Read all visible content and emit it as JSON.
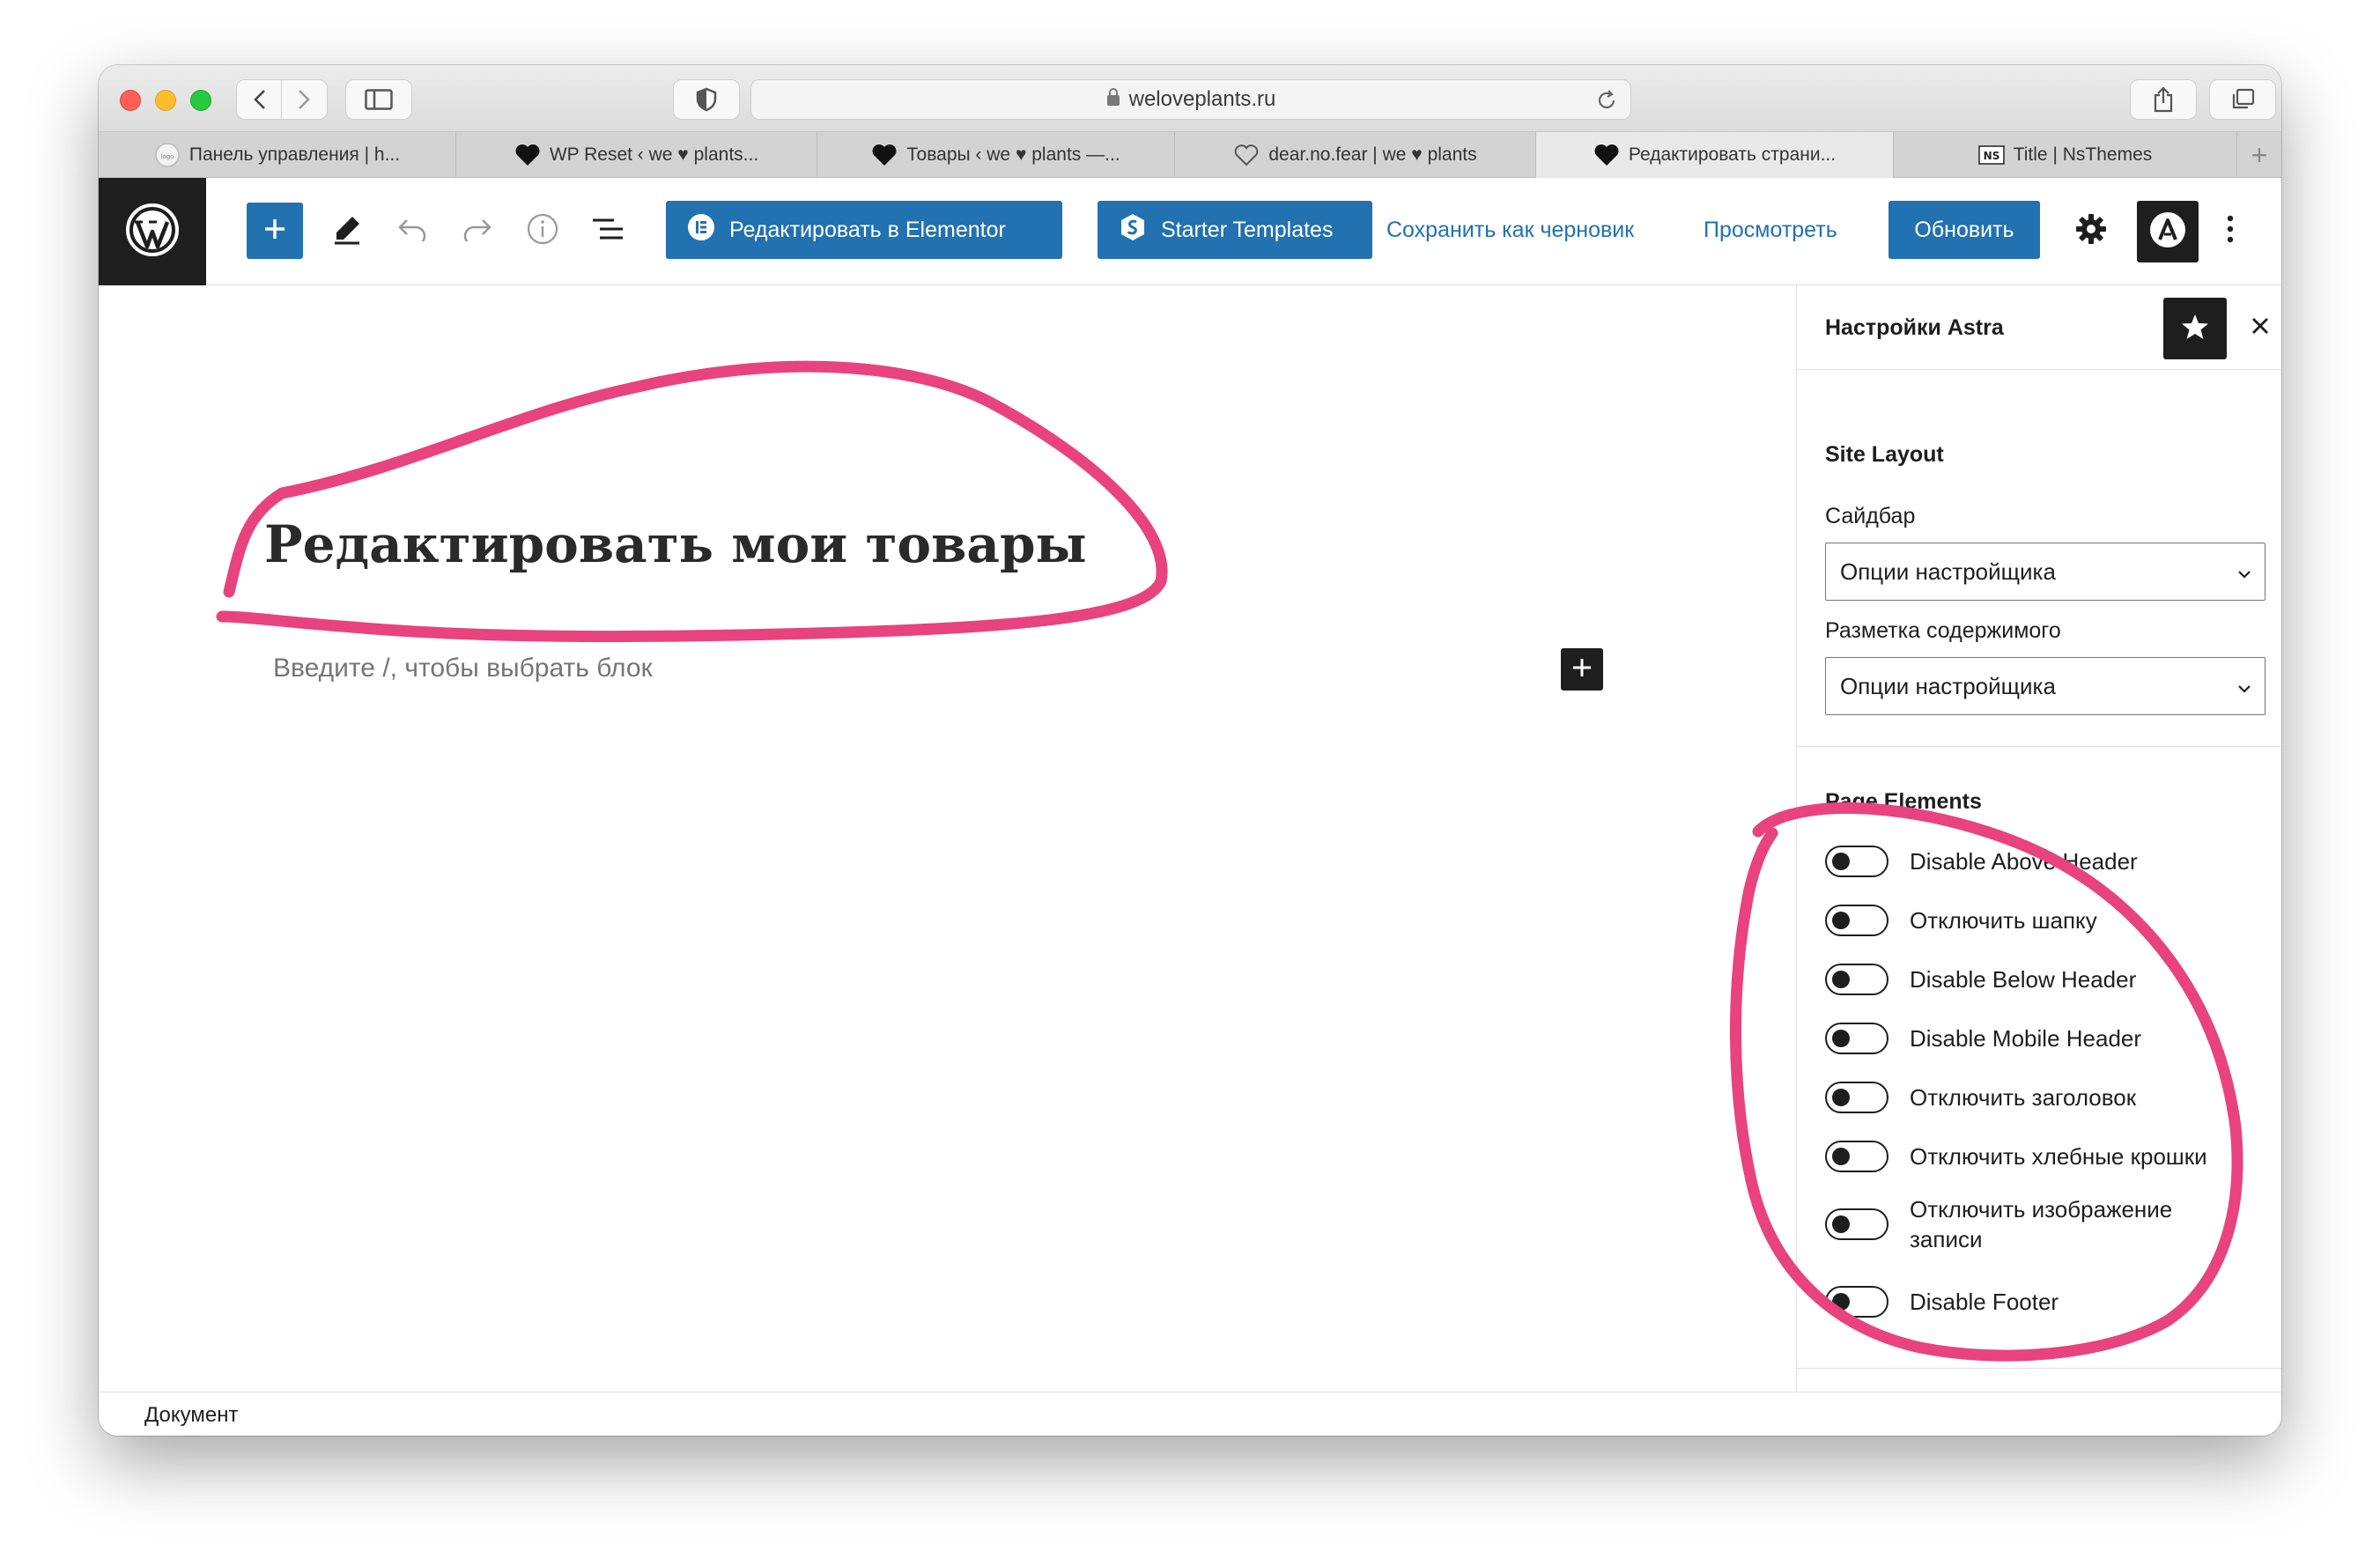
{
  "browser": {
    "address": "weloveplants.ru",
    "tabs": [
      {
        "label": "Панель управления | h...",
        "favicon": "site-logo-icon",
        "active": false
      },
      {
        "label": "WP Reset ‹ we ♥ plants...",
        "favicon": "heart-icon",
        "active": false
      },
      {
        "label": "Товары ‹ we ♥ plants —...",
        "favicon": "heart-icon",
        "active": false
      },
      {
        "label": "dear.no.fear | we ♥ plants",
        "favicon": "heart-outline-icon",
        "active": false
      },
      {
        "label": "Редактировать страни...",
        "favicon": "heart-icon",
        "active": true
      },
      {
        "label": "Title | NsThemes",
        "favicon": "ns-logo-icon",
        "active": false
      }
    ]
  },
  "toolbar": {
    "elementor_label": "Редактировать в Elementor",
    "starter_label": "Starter Templates",
    "save_draft_label": "Сохранить как черновик",
    "preview_label": "Просмотреть",
    "update_label": "Обновить",
    "accent": "#2271b1"
  },
  "editor": {
    "title": "Редактировать мои товары",
    "placeholder": "Введите /, чтобы выбрать блок"
  },
  "sidebar": {
    "title": "Настройки Astra",
    "site_layout": {
      "heading": "Site Layout",
      "sidebar_label": "Сайдбар",
      "sidebar_value": "Опции настройщика",
      "content_label": "Разметка содержимого",
      "content_value": "Опции настройщика"
    },
    "page_elements": {
      "heading": "Page Elements",
      "toggles": [
        {
          "label": "Disable Above Header",
          "checked": false
        },
        {
          "label": "Отключить шапку",
          "checked": false
        },
        {
          "label": "Disable Below Header",
          "checked": false
        },
        {
          "label": "Disable Mobile Header",
          "checked": false
        },
        {
          "label": "Отключить заголовок",
          "checked": false
        },
        {
          "label": "Отключить хлебные крошки",
          "checked": false
        },
        {
          "label": "Отключить изображение записи",
          "checked": false
        },
        {
          "label": "Disable Footer",
          "checked": false
        }
      ]
    }
  },
  "footer": {
    "label": "Документ"
  },
  "annotation_color": "#e8437d"
}
